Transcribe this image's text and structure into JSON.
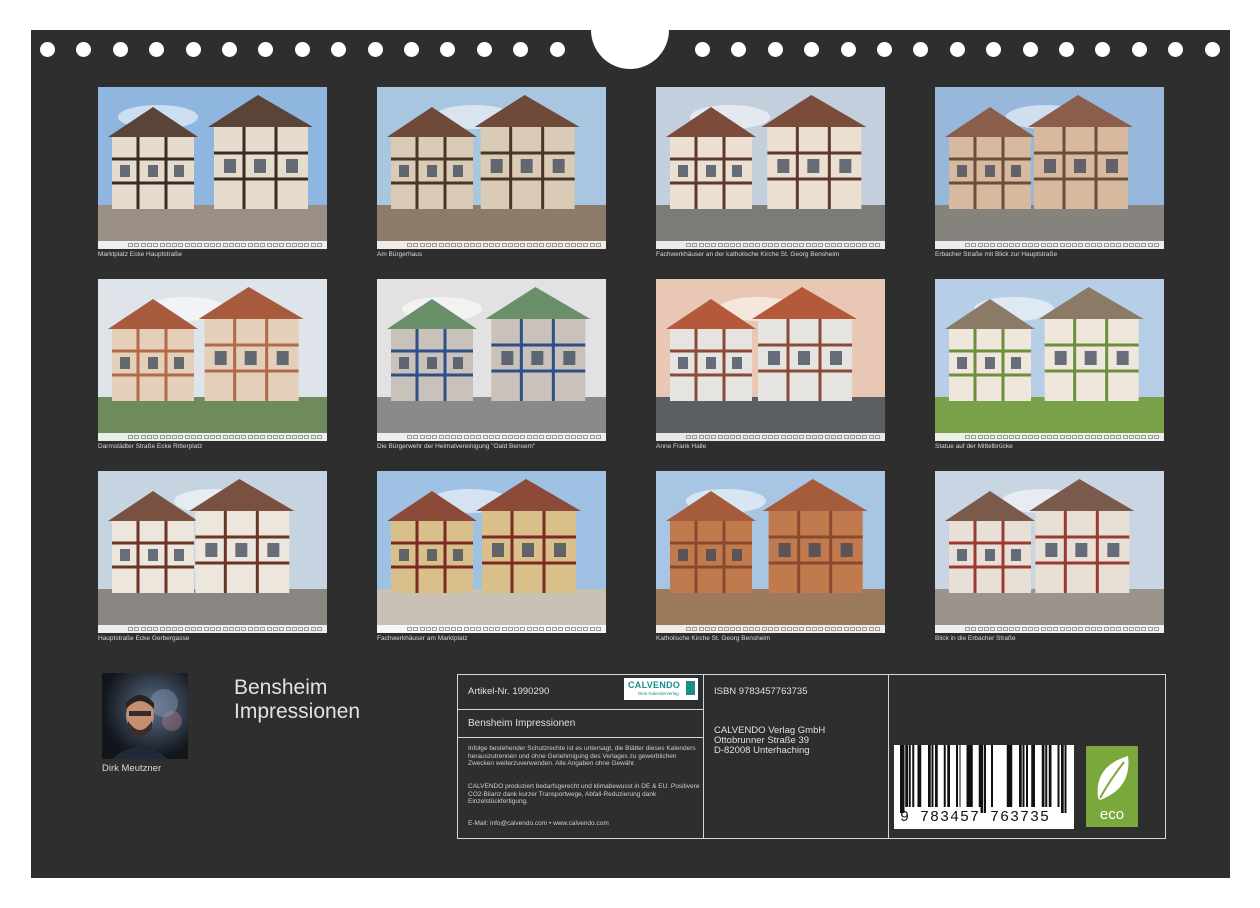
{
  "photos": [
    {
      "caption": "Marktplatz Ecke Hauptstraße",
      "sky": "#8fb6df",
      "wall": "#e6dccd",
      "beam": "#3b2b22",
      "roof": "#5a4438",
      "ground": "#9a8f84"
    },
    {
      "caption": "Am Bürgerhaus",
      "sky": "#a9c6e0",
      "wall": "#d9cbb5",
      "beam": "#4a3628",
      "roof": "#6f4a39",
      "ground": "#8c7b6a"
    },
    {
      "caption": "Fachwerkhäuser an der katholische Kirche St. Georg Bensheim",
      "sky": "#c3cfdc",
      "wall": "#ecdfd2",
      "beam": "#5a3a2c",
      "roof": "#7b4b3c",
      "ground": "#7b7b78"
    },
    {
      "caption": "Erbacher Straße mit Blick zur Hauptstraße",
      "sky": "#98b8db",
      "wall": "#d7b9a0",
      "beam": "#6a4e3c",
      "roof": "#8a5e4a",
      "ground": "#86827d"
    },
    {
      "caption": "Darmstädter Straße Ecke Ritterplatz",
      "sky": "#dfe4ea",
      "wall": "#e4d0b8",
      "beam": "#b06a48",
      "roof": "#a75a3c",
      "ground": "#6f8a5c"
    },
    {
      "caption": "Die Bürgerwehr der Heimatvereinigung \"Oald Bensem\"",
      "sky": "#e2e2e2",
      "wall": "#c9c2bb",
      "beam": "#2f4f8a",
      "roof": "#6b8f6a",
      "ground": "#8a8a8a"
    },
    {
      "caption": "Anne Frank Halle",
      "sky": "#e8c7b5",
      "wall": "#e6e4e0",
      "beam": "#8a4b34",
      "roof": "#b45a3a",
      "ground": "#5b5e62"
    },
    {
      "caption": "Statue auf der Mittelbrücke",
      "sky": "#b7cfe6",
      "wall": "#efe6dc",
      "beam": "#6b8f3a",
      "roof": "#8a7a66",
      "ground": "#7aa04a"
    },
    {
      "caption": "Hauptstraße Ecke Gerbergasse",
      "sky": "#c6d4e2",
      "wall": "#ece6dd",
      "beam": "#6a3426",
      "roof": "#7a5040",
      "ground": "#8a8682"
    },
    {
      "caption": "Fachwerkhäuser am Marktplatz",
      "sky": "#9fc1e3",
      "wall": "#d9c08a",
      "beam": "#7a2a22",
      "roof": "#8c4a38",
      "ground": "#c9c1b5"
    },
    {
      "caption": "Katholische Kirche St. Georg Bensheim",
      "sky": "#a8c6e4",
      "wall": "#c07a4e",
      "beam": "#8a4a2e",
      "roof": "#a45c3c",
      "ground": "#9a7a5a"
    },
    {
      "caption": "Blick in die Erbacher Straße",
      "sky": "#c9d5e2",
      "wall": "#e8e0d6",
      "beam": "#9a3a32",
      "roof": "#7a5a4a",
      "ground": "#9a948c"
    }
  ],
  "author": "Dirk Meutzner",
  "title": {
    "line1": "Bensheim",
    "line2": "Impressionen"
  },
  "info": {
    "article": "Artikel-Nr. 1990290",
    "product_title": "Bensheim Impressionen",
    "legal": "Infolge bestehender Schutzrechte ist es untersagt, die Blätter dieses Kalenders herauszutrennen und ohne Genehmigung des Verlages zu gewerblichen Zwecken weiterzuverwenden. Alle Angaben ohne Gewähr.",
    "eco_note": "CALVENDO produziert bedarfsgerecht und klimabewusst in DE & EU. Positivere CO2-Bilanz dank kurzer Transportwege, Abfall-Reduzierung dank Einzelstückfertigung.",
    "contact": "E-Mail: info@calvendo.com • www.calvendo.com",
    "isbn": "ISBN 9783457763735",
    "publisher_name": "CALVENDO Verlag GmbH",
    "publisher_street": "Ottobrunner Straße 39",
    "publisher_city": "D-82008 Unterhaching",
    "barcode_digits": "9 783457 763735",
    "logo_text": "CALVENDO",
    "logo_subtext": "Dein Kalenderverlag",
    "eco_label": "eco"
  },
  "colors": {
    "background": "#2e2e2e",
    "text": "#e0e0e0",
    "eco": "#7aa83a",
    "calvendo_teal": "#1c8c8c"
  }
}
